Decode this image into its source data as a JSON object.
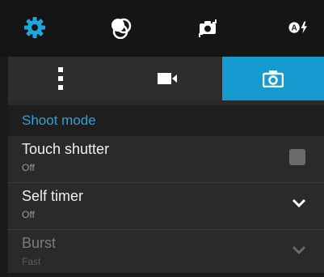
{
  "toolbar": {
    "icons": [
      "gear-icon",
      "color-effects-icon",
      "switch-camera-icon",
      "auto-flash-icon"
    ],
    "colors": {
      "background": "#151515",
      "icon": "#ffffff",
      "settings_accent": "#1ea6df"
    }
  },
  "tabs": [
    {
      "id": "more",
      "icon": "more-vertical-icon",
      "selected": false
    },
    {
      "id": "video",
      "icon": "video-camera-icon",
      "selected": false
    },
    {
      "id": "photo",
      "icon": "camera-icon",
      "selected": true
    }
  ],
  "colors": {
    "selected_tab": "#159bd0",
    "section_header_text": "#2aa2d8"
  },
  "section": {
    "title": "Shoot mode"
  },
  "settings": [
    {
      "title": "Touch shutter",
      "value": "Off",
      "control": "checkbox",
      "checked": false,
      "enabled": true
    },
    {
      "title": "Self timer",
      "value": "Off",
      "control": "dropdown",
      "enabled": true
    },
    {
      "title": "Burst",
      "value": "Fast",
      "control": "dropdown",
      "enabled": false
    }
  ]
}
